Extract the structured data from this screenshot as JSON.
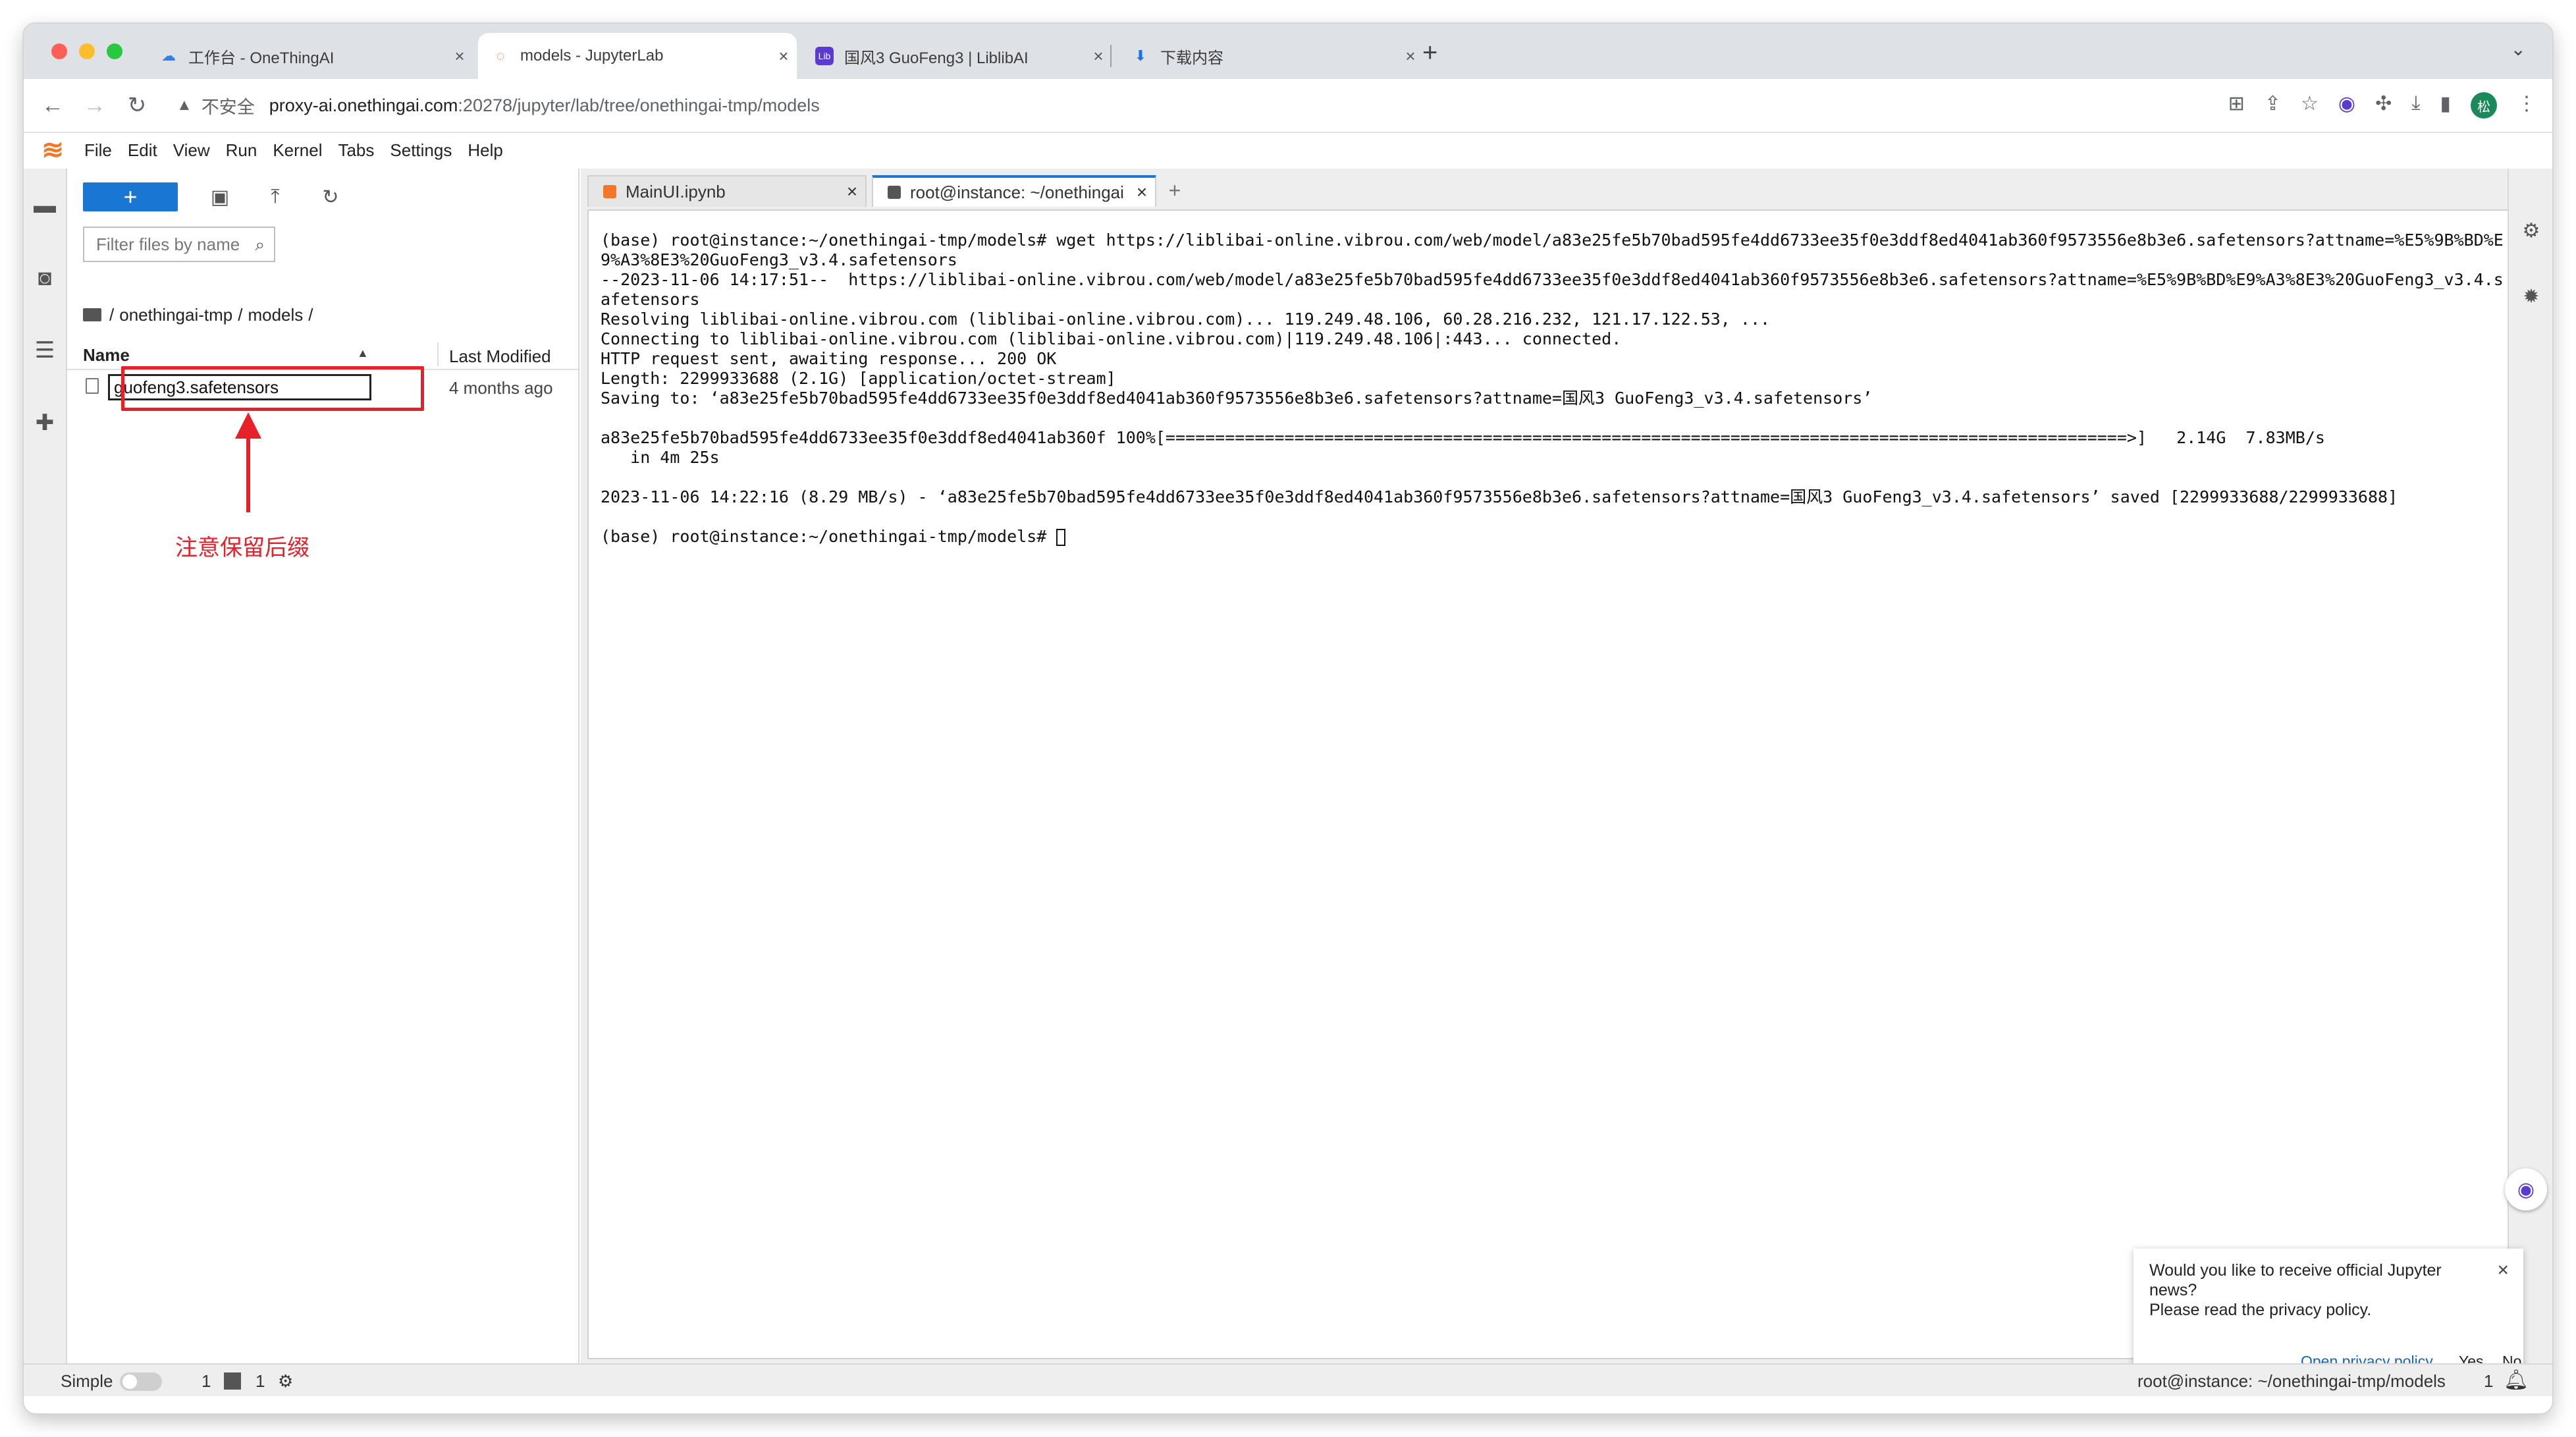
{
  "browser": {
    "tabs": [
      {
        "title": "工作台 - OneThingAI",
        "icon": "cloud-icon"
      },
      {
        "title": "models - JupyterLab",
        "icon": "jupyter-icon"
      },
      {
        "title": "国风3 GuoFeng3 | LiblibAI",
        "icon": "liblib-icon"
      },
      {
        "title": "下载内容",
        "icon": "download-icon"
      }
    ],
    "security_label": "不安全",
    "url_host": "proxy-ai.onethingai.com",
    "url_path": ":20278/jupyter/lab/tree/onethingai-tmp/models",
    "avatar_letter": "松"
  },
  "menu": [
    "File",
    "Edit",
    "View",
    "Run",
    "Kernel",
    "Tabs",
    "Settings",
    "Help"
  ],
  "filebrowser": {
    "new_button": "+",
    "filter_placeholder": "Filter files by name",
    "breadcrumb": [
      "/",
      "onethingai-tmp",
      "/",
      "models",
      "/"
    ],
    "col_name": "Name",
    "col_modified": "Last Modified",
    "files": [
      {
        "name": "guofeng3.safetensors",
        "modified": "4 months ago"
      }
    ]
  },
  "annotation": "注意保留后缀",
  "doc_tabs": [
    {
      "title": "MainUI.ipynb"
    },
    {
      "title": "root@instance: ~/onethingai"
    }
  ],
  "terminal_lines": [
    "(base) root@instance:~/onethingai-tmp/models# wget https://liblibai-online.vibrou.com/web/model/a83e25fe5b70bad595fe4dd6733ee35f0e3ddf8ed4041ab360f9573556e8b3e6.safetensors?attname=%E5%9B%BD%E",
    "9%A3%8E3%20GuoFeng3_v3.4.safetensors",
    "--2023-11-06 14:17:51--  https://liblibai-online.vibrou.com/web/model/a83e25fe5b70bad595fe4dd6733ee35f0e3ddf8ed4041ab360f9573556e8b3e6.safetensors?attname=%E5%9B%BD%E9%A3%8E3%20GuoFeng3_v3.4.s",
    "afetensors",
    "Resolving liblibai-online.vibrou.com (liblibai-online.vibrou.com)... 119.249.48.106, 60.28.216.232, 121.17.122.53, ...",
    "Connecting to liblibai-online.vibrou.com (liblibai-online.vibrou.com)|119.249.48.106|:443... connected.",
    "HTTP request sent, awaiting response... 200 OK",
    "Length: 2299933688 (2.1G) [application/octet-stream]",
    "Saving to: ‘a83e25fe5b70bad595fe4dd6733ee35f0e3ddf8ed4041ab360f9573556e8b3e6.safetensors?attname=国风3 GuoFeng3_v3.4.safetensors’",
    "",
    "a83e25fe5b70bad595fe4dd6733ee35f0e3ddf8ed4041ab360f 100%[=================================================================================================>]   2.14G  7.83MB/s",
    "   in 4m 25s",
    "",
    "2023-11-06 14:22:16 (8.29 MB/s) - ‘a83e25fe5b70bad595fe4dd6733ee35f0e3ddf8ed4041ab360f9573556e8b3e6.safetensors?attname=国风3 GuoFeng3_v3.4.safetensors’ saved [2299933688/2299933688]",
    "",
    "(base) root@instance:~/onethingai-tmp/models# "
  ],
  "notification": {
    "message_line1": "Would you like to receive official Jupyter news?",
    "message_line2": "Please read the privacy policy.",
    "privacy_link": "Open privacy policy",
    "yes": "Yes",
    "no": "No"
  },
  "statusbar": {
    "mode": "Simple",
    "count1": "1",
    "count2": "1",
    "path": "root@instance: ~/onethingai-tmp/models",
    "notif_count": "1"
  },
  "colors": {
    "accent": "#1976d2",
    "annotation": "#e8202a",
    "jupyter": "#f37726"
  }
}
